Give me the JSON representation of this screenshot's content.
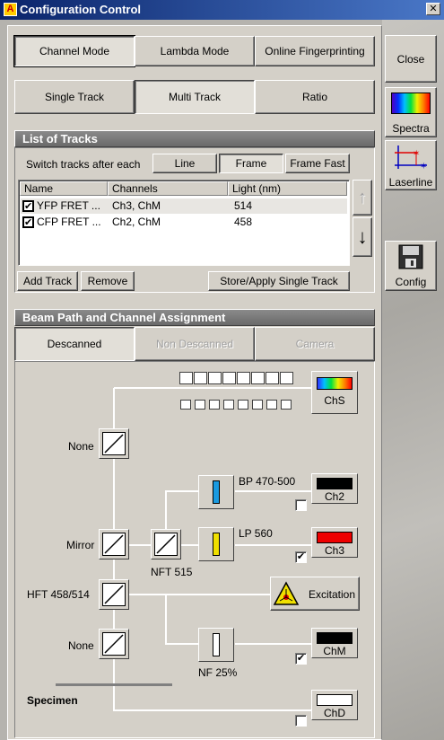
{
  "window": {
    "title": "Configuration Control",
    "close_glyph": "✕"
  },
  "colors": {
    "titlebar": "#0a246a",
    "panel": "#d4d0c8",
    "section_header": "#7a7a7a",
    "ch3_red": "#ee0000",
    "bp_blue": "#1a9ae0",
    "lp_yellow": "#f0e000"
  },
  "mode_tabs": [
    {
      "label": "Channel Mode",
      "selected": true
    },
    {
      "label": "Lambda Mode",
      "selected": false
    },
    {
      "label": "Online Fingerprinting",
      "selected": false
    }
  ],
  "track_tabs": [
    {
      "label": "Single Track",
      "selected": false
    },
    {
      "label": "Multi Track",
      "selected": true
    },
    {
      "label": "Ratio",
      "selected": false
    }
  ],
  "tracks": {
    "title": "List of Tracks",
    "switch_label": "Switch tracks after each",
    "switch_options": [
      {
        "label": "Line",
        "selected": false
      },
      {
        "label": "Frame",
        "selected": true
      },
      {
        "label": "Frame Fast",
        "selected": false
      }
    ],
    "columns": [
      "Name",
      "Channels",
      "Light (nm)"
    ],
    "rows": [
      {
        "checked": true,
        "name": "YFP FRET ...",
        "channels": "Ch3, ChM",
        "light": "514"
      },
      {
        "checked": true,
        "name": "CFP FRET ...",
        "channels": "Ch2, ChM",
        "light": "458"
      }
    ],
    "buttons": {
      "add": "Add Track",
      "remove": "Remove",
      "store": "Store/Apply Single Track"
    },
    "up_arrow": "↑",
    "down_arrow": "↓"
  },
  "beam": {
    "title": "Beam Path and Channel Assignment",
    "tabs": [
      {
        "label": "Descanned",
        "selected": true,
        "enabled": true
      },
      {
        "label": "Non Descanned",
        "selected": false,
        "enabled": false
      },
      {
        "label": "Camera",
        "selected": false,
        "enabled": false
      }
    ],
    "mirror_labels": {
      "top": "None",
      "mirror": "Mirror",
      "hft": "HFT 458/514",
      "bottom": "None"
    },
    "nft_label": "NFT 515",
    "filters": {
      "bp": "BP 470-500",
      "lp": "LP 560",
      "nf": "NF 25%"
    },
    "channels": {
      "chs": "ChS",
      "ch2": {
        "label": "Ch2",
        "checked": false
      },
      "ch3": {
        "label": "Ch3",
        "checked": true
      },
      "chm": {
        "label": "ChM",
        "checked": true
      },
      "chd": {
        "label": "ChD",
        "checked": false
      }
    },
    "excitation": "Excitation",
    "specimen": "Specimen",
    "check_glyph": "✔"
  },
  "side": {
    "close": "Close",
    "spectra": "Spectra",
    "laserline": "Laserline",
    "config": "Config"
  }
}
